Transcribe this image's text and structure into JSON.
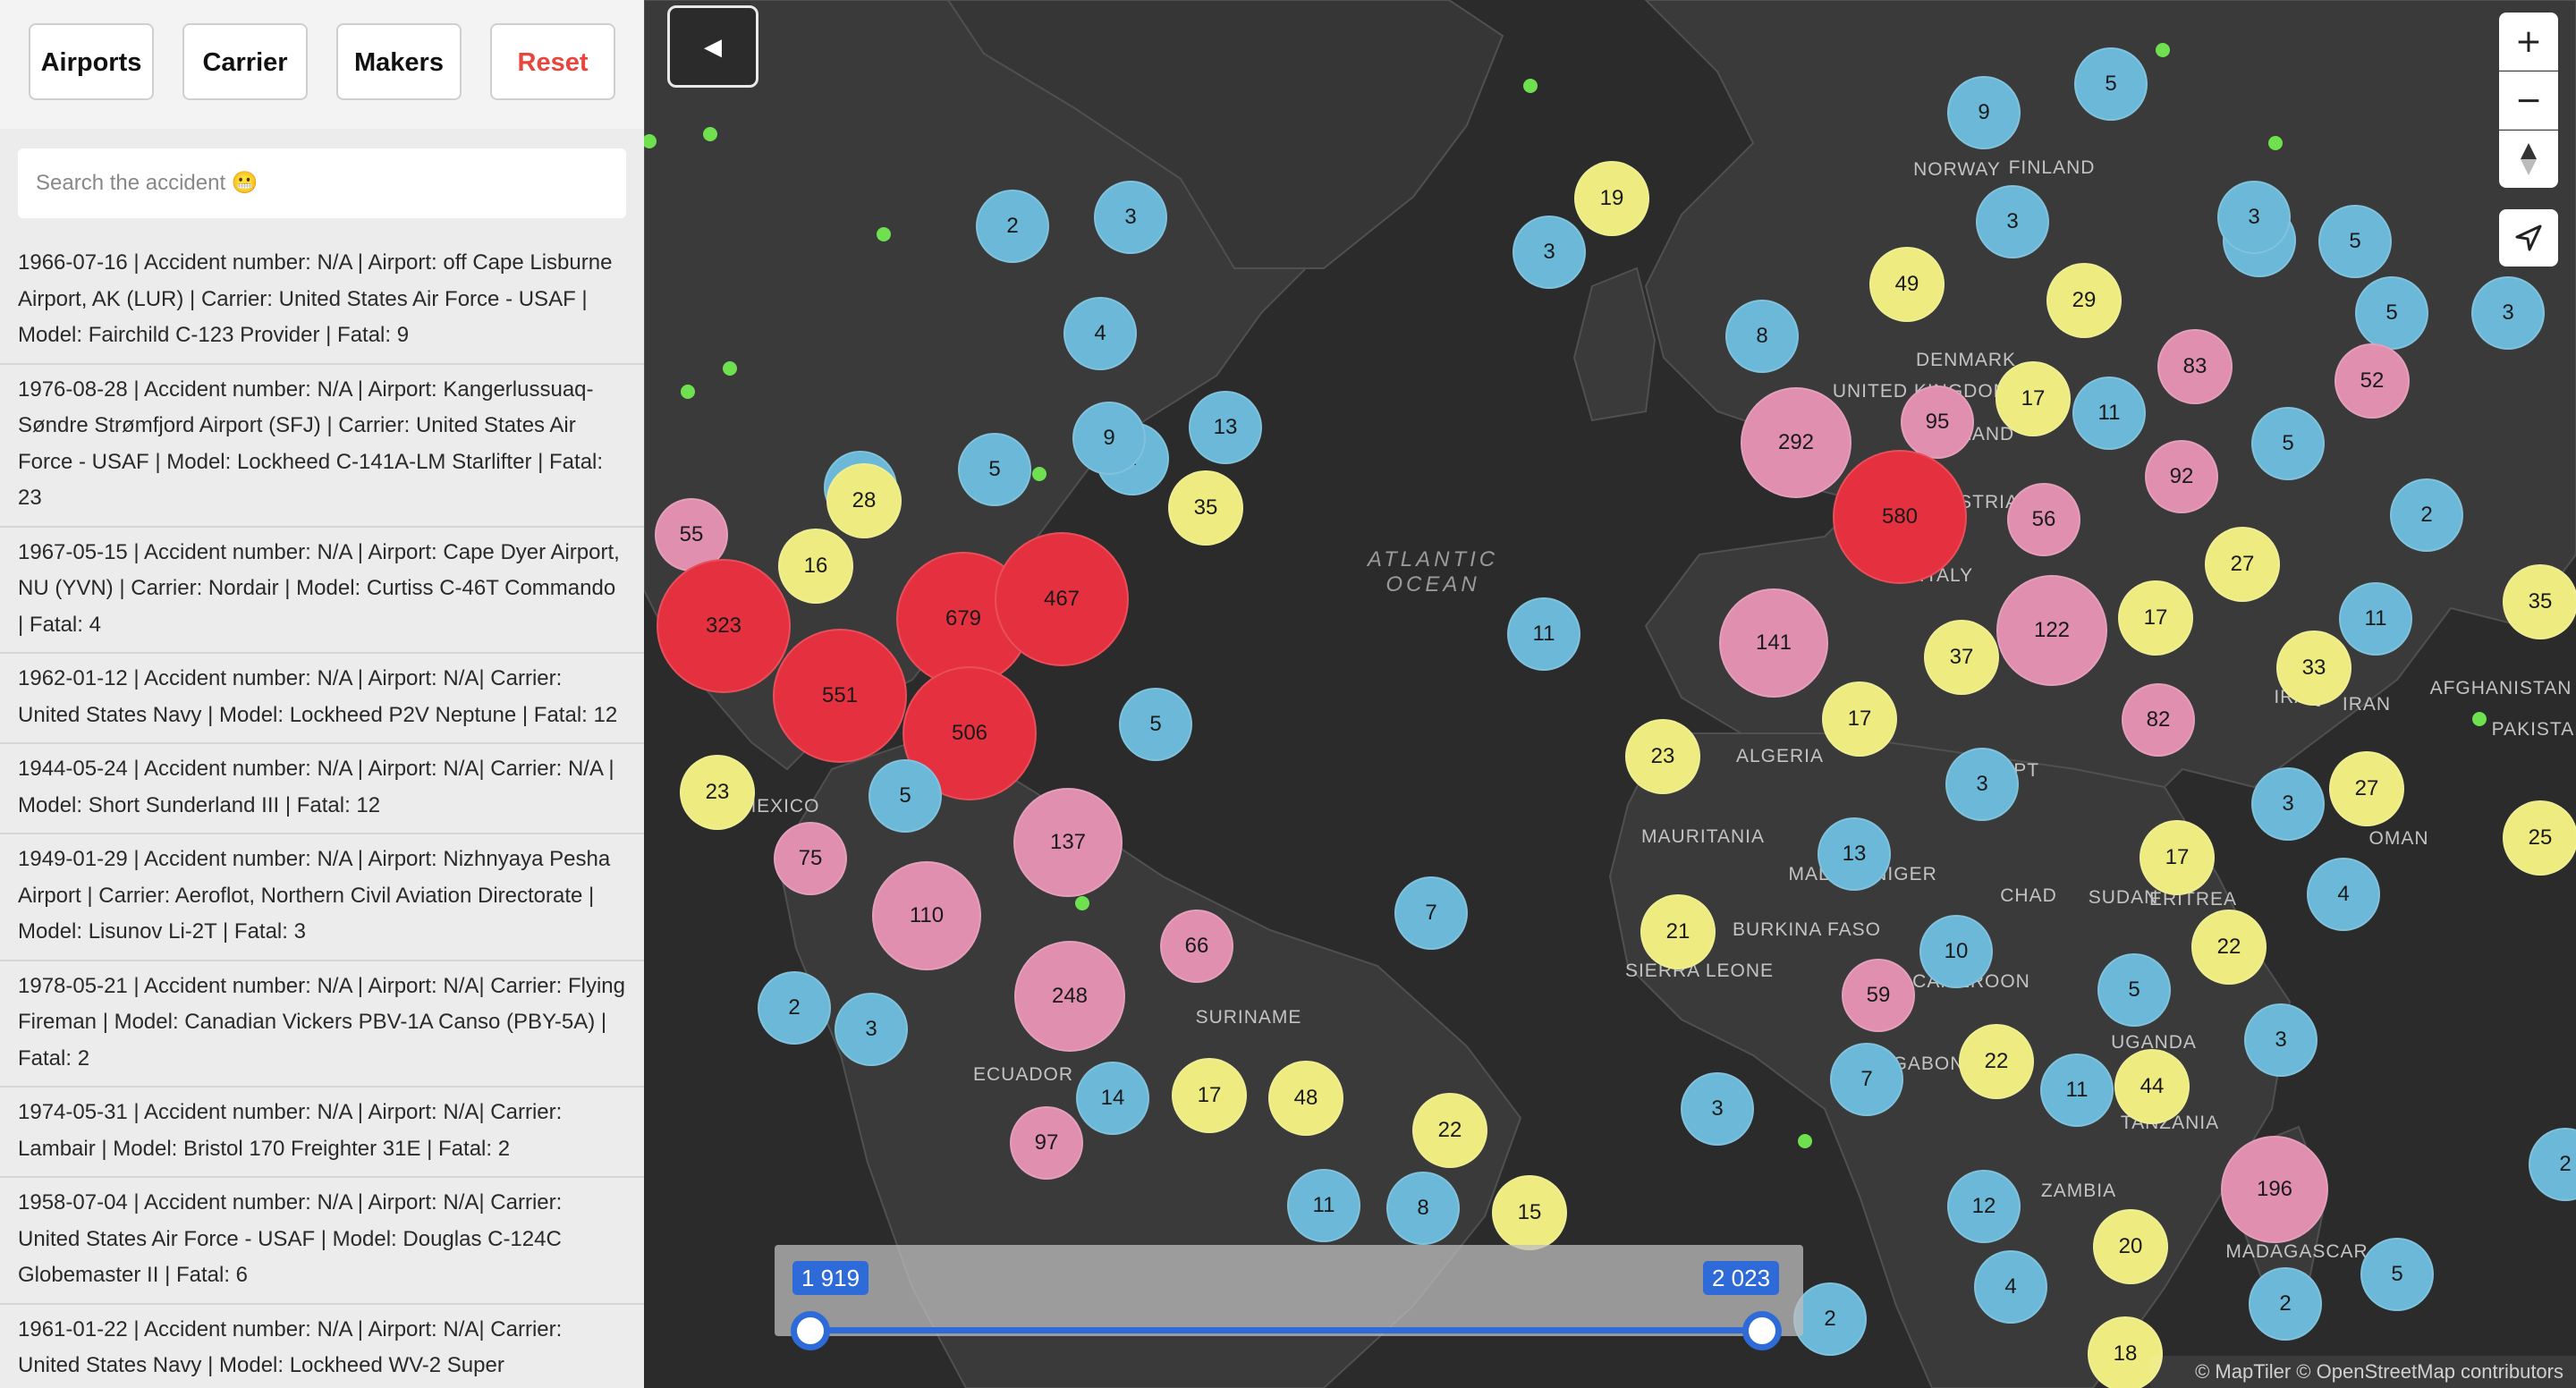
{
  "toolbar": {
    "airports_label": "Airports",
    "carrier_label": "Carrier",
    "makers_label": "Makers",
    "reset_label": "Reset",
    "reset_color": "#e8453c"
  },
  "search": {
    "placeholder": "Search the accident 😬"
  },
  "accidents": [
    "1966-07-16 | Accident number: N/A | Airport: off Cape Lisburne Airport, AK (LUR) | Carrier: United States Air Force - USAF | Model: Fairchild C-123 Provider | Fatal: 9",
    "1976-08-28 | Accident number: N/A | Airport: Kangerlussuaq-Søndre Strømfjord Airport (SFJ) | Carrier: United States Air Force - USAF | Model: Lockheed C-141A-LM Starlifter | Fatal: 23",
    "1967-05-15 | Accident number: N/A | Airport: Cape Dyer Airport, NU (YVN) | Carrier: Nordair | Model: Curtiss C-46T Commando | Fatal: 4",
    "1962-01-12 | Accident number: N/A | Airport: N/A| Carrier: United States Navy | Model: Lockheed P2V Neptune | Fatal: 12",
    "1944-05-24 | Accident number: N/A | Airport: N/A| Carrier: N/A | Model: Short Sunderland III | Fatal: 12",
    "1949-01-29 | Accident number: N/A | Airport: Nizhnyaya Pesha Airport | Carrier: Aeroflot, Northern Civil Aviation Directorate | Model: Lisunov Li-2T | Fatal: 3",
    "1978-05-21 | Accident number: N/A | Airport: N/A| Carrier: Flying Fireman | Model: Canadian Vickers PBV-1A Canso (PBY-5A) | Fatal: 2",
    "1974-05-31 | Accident number: N/A | Airport: N/A| Carrier: Lambair | Model: Bristol 170 Freighter 31E | Fatal: 2",
    "1958-07-04 | Accident number: N/A | Airport: N/A| Carrier: United States Air Force - USAF | Model: Douglas C-124C Globemaster II | Fatal: 6",
    "1961-01-22 | Accident number: N/A | Airport: N/A| Carrier: United States Navy | Model: Lockheed WV-2 Super"
  ],
  "map": {
    "toggle_icon": "◀",
    "zoom_in": "+",
    "zoom_out": "−",
    "attribution": "© MapTiler © OpenStreetMap contributors",
    "ocean_label": [
      "ATLANTIC",
      "OCEAN"
    ],
    "colors": {
      "blue": "#6bb8d8",
      "yellow": "#eeec80",
      "pink": "#e08fae",
      "red": "#e5313f",
      "dot": "#6fe04f"
    },
    "labels": [
      "NORWAY",
      "FINLAND",
      "DENMARK",
      "UNITED KINGDOM",
      "POLAND",
      "AUSTRIA",
      "ITALY",
      "ALGERIA",
      "EGYPT",
      "MAURITANIA",
      "MALI",
      "NIGER",
      "CHAD",
      "SUDAN",
      "ERITREA",
      "BURKINA FASO",
      "SIERRA LEONE",
      "CAMEROON",
      "GABON",
      "UGANDA",
      "TANZANIA",
      "ZAMBIA",
      "MADAGASCAR",
      "IRAQ",
      "IRAN",
      "AFGHANISTAN",
      "PAKISTAN",
      "OMAN",
      "SURINAME",
      "ECUADOR",
      "MEXICO"
    ],
    "clusters": [
      {
        "value": "2",
        "color": "blue"
      },
      {
        "value": "3",
        "color": "blue"
      },
      {
        "value": "4",
        "color": "blue"
      },
      {
        "value": "4",
        "color": "blue"
      },
      {
        "value": "9",
        "color": "blue"
      },
      {
        "value": "13",
        "color": "blue"
      },
      {
        "value": "5",
        "color": "blue"
      },
      {
        "value": "7",
        "color": "blue"
      },
      {
        "value": "28",
        "color": "yellow"
      },
      {
        "value": "35",
        "color": "yellow"
      },
      {
        "value": "55",
        "color": "pink"
      },
      {
        "value": "16",
        "color": "yellow"
      },
      {
        "value": "323",
        "color": "red"
      },
      {
        "value": "679",
        "color": "red"
      },
      {
        "value": "467",
        "color": "red"
      },
      {
        "value": "551",
        "color": "red"
      },
      {
        "value": "506",
        "color": "red"
      },
      {
        "value": "5",
        "color": "blue"
      },
      {
        "value": "23",
        "color": "yellow"
      },
      {
        "value": "5",
        "color": "blue"
      },
      {
        "value": "75",
        "color": "pink"
      },
      {
        "value": "137",
        "color": "pink"
      },
      {
        "value": "110",
        "color": "pink"
      },
      {
        "value": "66",
        "color": "pink"
      },
      {
        "value": "248",
        "color": "pink"
      },
      {
        "value": "2",
        "color": "blue"
      },
      {
        "value": "3",
        "color": "blue"
      },
      {
        "value": "14",
        "color": "blue"
      },
      {
        "value": "17",
        "color": "yellow"
      },
      {
        "value": "48",
        "color": "yellow"
      },
      {
        "value": "97",
        "color": "pink"
      },
      {
        "value": "22",
        "color": "yellow"
      },
      {
        "value": "11",
        "color": "blue"
      },
      {
        "value": "8",
        "color": "blue"
      },
      {
        "value": "15",
        "color": "yellow"
      },
      {
        "value": "7",
        "color": "blue"
      },
      {
        "value": "11",
        "color": "blue"
      },
      {
        "value": "19",
        "color": "yellow"
      },
      {
        "value": "9",
        "color": "blue"
      },
      {
        "value": "5",
        "color": "blue"
      },
      {
        "value": "3",
        "color": "blue"
      },
      {
        "value": "5",
        "color": "blue"
      },
      {
        "value": "3",
        "color": "blue"
      },
      {
        "value": "5",
        "color": "blue"
      },
      {
        "value": "5",
        "color": "blue"
      },
      {
        "value": "3",
        "color": "blue"
      },
      {
        "value": "3",
        "color": "blue"
      },
      {
        "value": "8",
        "color": "blue"
      },
      {
        "value": "49",
        "color": "yellow"
      },
      {
        "value": "29",
        "color": "yellow"
      },
      {
        "value": "292",
        "color": "pink"
      },
      {
        "value": "95",
        "color": "pink"
      },
      {
        "value": "17",
        "color": "yellow"
      },
      {
        "value": "11",
        "color": "blue"
      },
      {
        "value": "83",
        "color": "pink"
      },
      {
        "value": "52",
        "color": "pink"
      },
      {
        "value": "5",
        "color": "blue"
      },
      {
        "value": "580",
        "color": "red"
      },
      {
        "value": "56",
        "color": "pink"
      },
      {
        "value": "92",
        "color": "pink"
      },
      {
        "value": "2",
        "color": "blue"
      },
      {
        "value": "27",
        "color": "yellow"
      },
      {
        "value": "141",
        "color": "pink"
      },
      {
        "value": "37",
        "color": "yellow"
      },
      {
        "value": "122",
        "color": "pink"
      },
      {
        "value": "17",
        "color": "yellow"
      },
      {
        "value": "11",
        "color": "blue"
      },
      {
        "value": "35",
        "color": "yellow"
      },
      {
        "value": "33",
        "color": "yellow"
      },
      {
        "value": "17",
        "color": "yellow"
      },
      {
        "value": "82",
        "color": "pink"
      },
      {
        "value": "23",
        "color": "yellow"
      },
      {
        "value": "3",
        "color": "blue"
      },
      {
        "value": "3",
        "color": "blue"
      },
      {
        "value": "27",
        "color": "yellow"
      },
      {
        "value": "25",
        "color": "yellow"
      },
      {
        "value": "13",
        "color": "blue"
      },
      {
        "value": "17",
        "color": "yellow"
      },
      {
        "value": "4",
        "color": "blue"
      },
      {
        "value": "21",
        "color": "yellow"
      },
      {
        "value": "10",
        "color": "blue"
      },
      {
        "value": "22",
        "color": "yellow"
      },
      {
        "value": "59",
        "color": "pink"
      },
      {
        "value": "5",
        "color": "blue"
      },
      {
        "value": "3",
        "color": "blue"
      },
      {
        "value": "7",
        "color": "blue"
      },
      {
        "value": "22",
        "color": "yellow"
      },
      {
        "value": "11",
        "color": "blue"
      },
      {
        "value": "44",
        "color": "yellow"
      },
      {
        "value": "196",
        "color": "pink"
      },
      {
        "value": "12",
        "color": "blue"
      },
      {
        "value": "20",
        "color": "yellow"
      },
      {
        "value": "4",
        "color": "blue"
      },
      {
        "value": "2",
        "color": "blue"
      },
      {
        "value": "5",
        "color": "blue"
      },
      {
        "value": "18",
        "color": "yellow"
      },
      {
        "value": "2",
        "color": "blue"
      },
      {
        "value": "2",
        "color": "blue"
      },
      {
        "value": "3",
        "color": "blue"
      }
    ]
  },
  "year_slider": {
    "min_label": "1 919",
    "max_label": "2 023",
    "range": [
      1919,
      2023
    ],
    "selected": [
      1919,
      2023
    ]
  }
}
